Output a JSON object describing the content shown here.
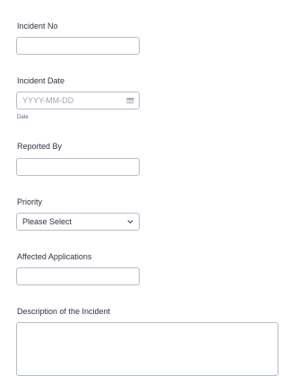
{
  "form": {
    "incident_no": {
      "label": "Incident No",
      "value": "",
      "placeholder": ""
    },
    "incident_date": {
      "label": "Incident Date",
      "value": "",
      "placeholder": "YYYY-MM-DD",
      "sublabel": "Date",
      "icon": "calendar-icon"
    },
    "reported_by": {
      "label": "Reported By",
      "value": "",
      "placeholder": ""
    },
    "priority": {
      "label": "Priority",
      "selected": "Please Select",
      "icon": "chevron-down-icon"
    },
    "affected_applications": {
      "label": "Affected Applications",
      "value": "",
      "placeholder": ""
    },
    "description": {
      "label": "Description of the Incident",
      "value": ""
    }
  },
  "colors": {
    "label_text": "#2c3345",
    "input_border": "#b8bdc9",
    "placeholder_text": "#a0a6b2",
    "sublabel_text": "#57647e",
    "background": "#ffffff"
  }
}
